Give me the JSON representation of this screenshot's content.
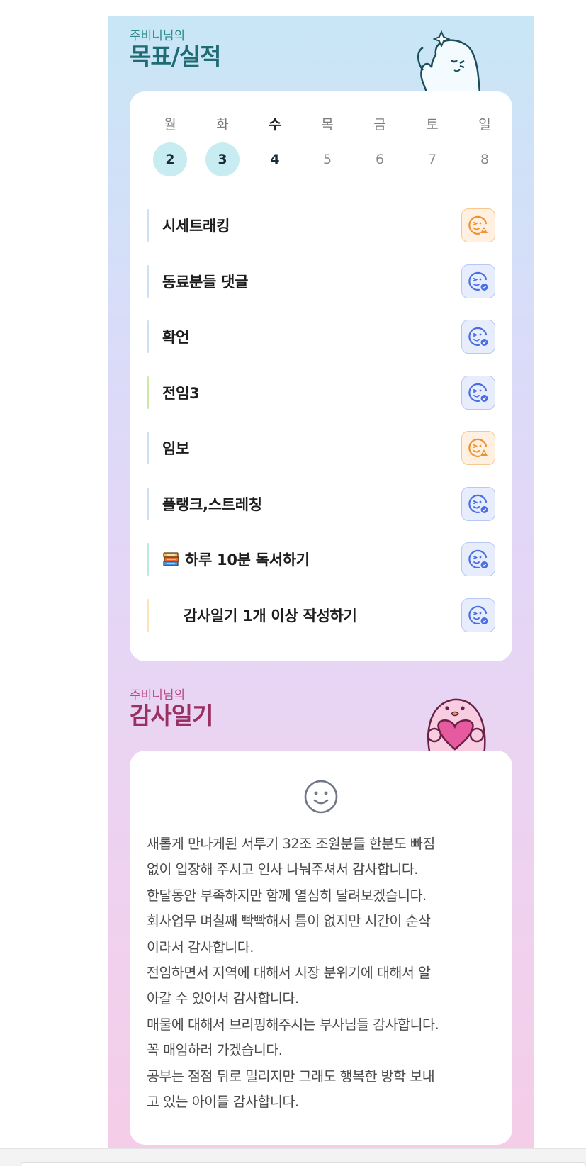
{
  "goal_section": {
    "subtitle": "주비니님의",
    "title": "목표/실적",
    "weekdays": [
      "월",
      "화",
      "수",
      "목",
      "금",
      "토",
      "일"
    ],
    "dates": [
      "2",
      "3",
      "4",
      "5",
      "6",
      "7",
      "8"
    ],
    "goals": [
      {
        "label": "시세트래킹",
        "status": "warning-face-icon",
        "bar_color": "#cfe0f5"
      },
      {
        "label": "동료분들 댓글",
        "status": "check-face-icon",
        "bar_color": "#cfe0f5"
      },
      {
        "label": "확언",
        "status": "check-face-icon",
        "bar_color": "#cfe0f5"
      },
      {
        "label": "전임3",
        "status": "check-face-icon",
        "bar_color": "#cde9a8"
      },
      {
        "label": "임보",
        "status": "warning-face-icon",
        "bar_color": "#cfe0f5"
      },
      {
        "label": "플랭크,스트레칭",
        "status": "check-face-icon",
        "bar_color": "#cfe0f5"
      },
      {
        "label": "하루 10분 독서하기",
        "status": "check-face-icon",
        "bar_color": "#b9ecd9"
      },
      {
        "label": "감사일기 1개 이상 작성하기",
        "status": "check-face-icon",
        "bar_color": "#fbe2b8"
      }
    ]
  },
  "thanks_section": {
    "subtitle": "주비니님의",
    "title": "감사일기",
    "diary_text": "새롭게 만나게된 서투기 32조 조원분들 한분도 빠짐\n없이 입장해 주시고 인사 나눠주셔서 감사합니다.\n한달동안 부족하지만 함께 열심히 달려보겠습니다.\n회사업무 며칠째 빡빡해서 틈이 없지만 시간이 순삭\n이라서 감사합니다.\n전임하면서 지역에 대해서 시장 분위기에 대해서 알\n아갈 수 있어서 감사합니다.\n매물에 대해서 브리핑해주시는 부사님들 감사합니다.\n꼭 매임하러 가겠습니다.\n공부는 점점 뒤로 밀리지만 그래도 행복한 방학 보내\n고 있는 아이들 감사합니다."
  },
  "colors": {
    "accent_teal": "#1f6b73",
    "accent_pink": "#9a2f62",
    "done_blue": "#4a6fe0",
    "warn_orange": "#f0912e",
    "done_date_bg": "#c7ecf2"
  }
}
